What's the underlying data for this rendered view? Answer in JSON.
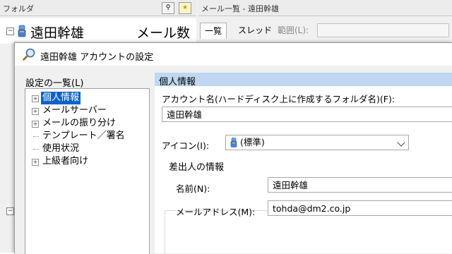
{
  "folder_pane": {
    "header_title": "フォルダ",
    "account_name": "遠田幹雄",
    "mail_count_label": "メール数"
  },
  "mail_list": {
    "header_title": "メール一覧 - 遠田幹雄",
    "tabs": [
      "一覧",
      "スレッド"
    ],
    "range_label": "範囲(L):"
  },
  "dialog": {
    "title": "遠田幹雄 アカウントの設定",
    "settings_list_label": "設定の一覧(L)",
    "tree_items": [
      {
        "label": "個人情報",
        "expandable": true,
        "selected": true
      },
      {
        "label": "メールサーバー",
        "expandable": true,
        "selected": false
      },
      {
        "label": "メールの振り分け",
        "expandable": true,
        "selected": false
      },
      {
        "label": "テンプレート／署名",
        "expandable": false,
        "selected": false
      },
      {
        "label": "使用状況",
        "expandable": false,
        "selected": false
      },
      {
        "label": "上級者向け",
        "expandable": true,
        "selected": false
      }
    ],
    "section_title": "個人情報",
    "account_name_label": "アカウント名(ハードディスク上に作成するフォルダ名)(F):",
    "account_name_value": "遠田幹雄",
    "icon_label": "アイコン(I):",
    "icon_value": "(標準)",
    "sender_group_label": "差出人の情報",
    "name_label": "名前(N):",
    "name_value": "遠田幹雄",
    "email_label": "メールアドレス(M):",
    "email_value": "tohda@dm2.co.jp"
  },
  "colors": {
    "selection": "#0a64c8",
    "section_bar": "#bfd7f0"
  }
}
